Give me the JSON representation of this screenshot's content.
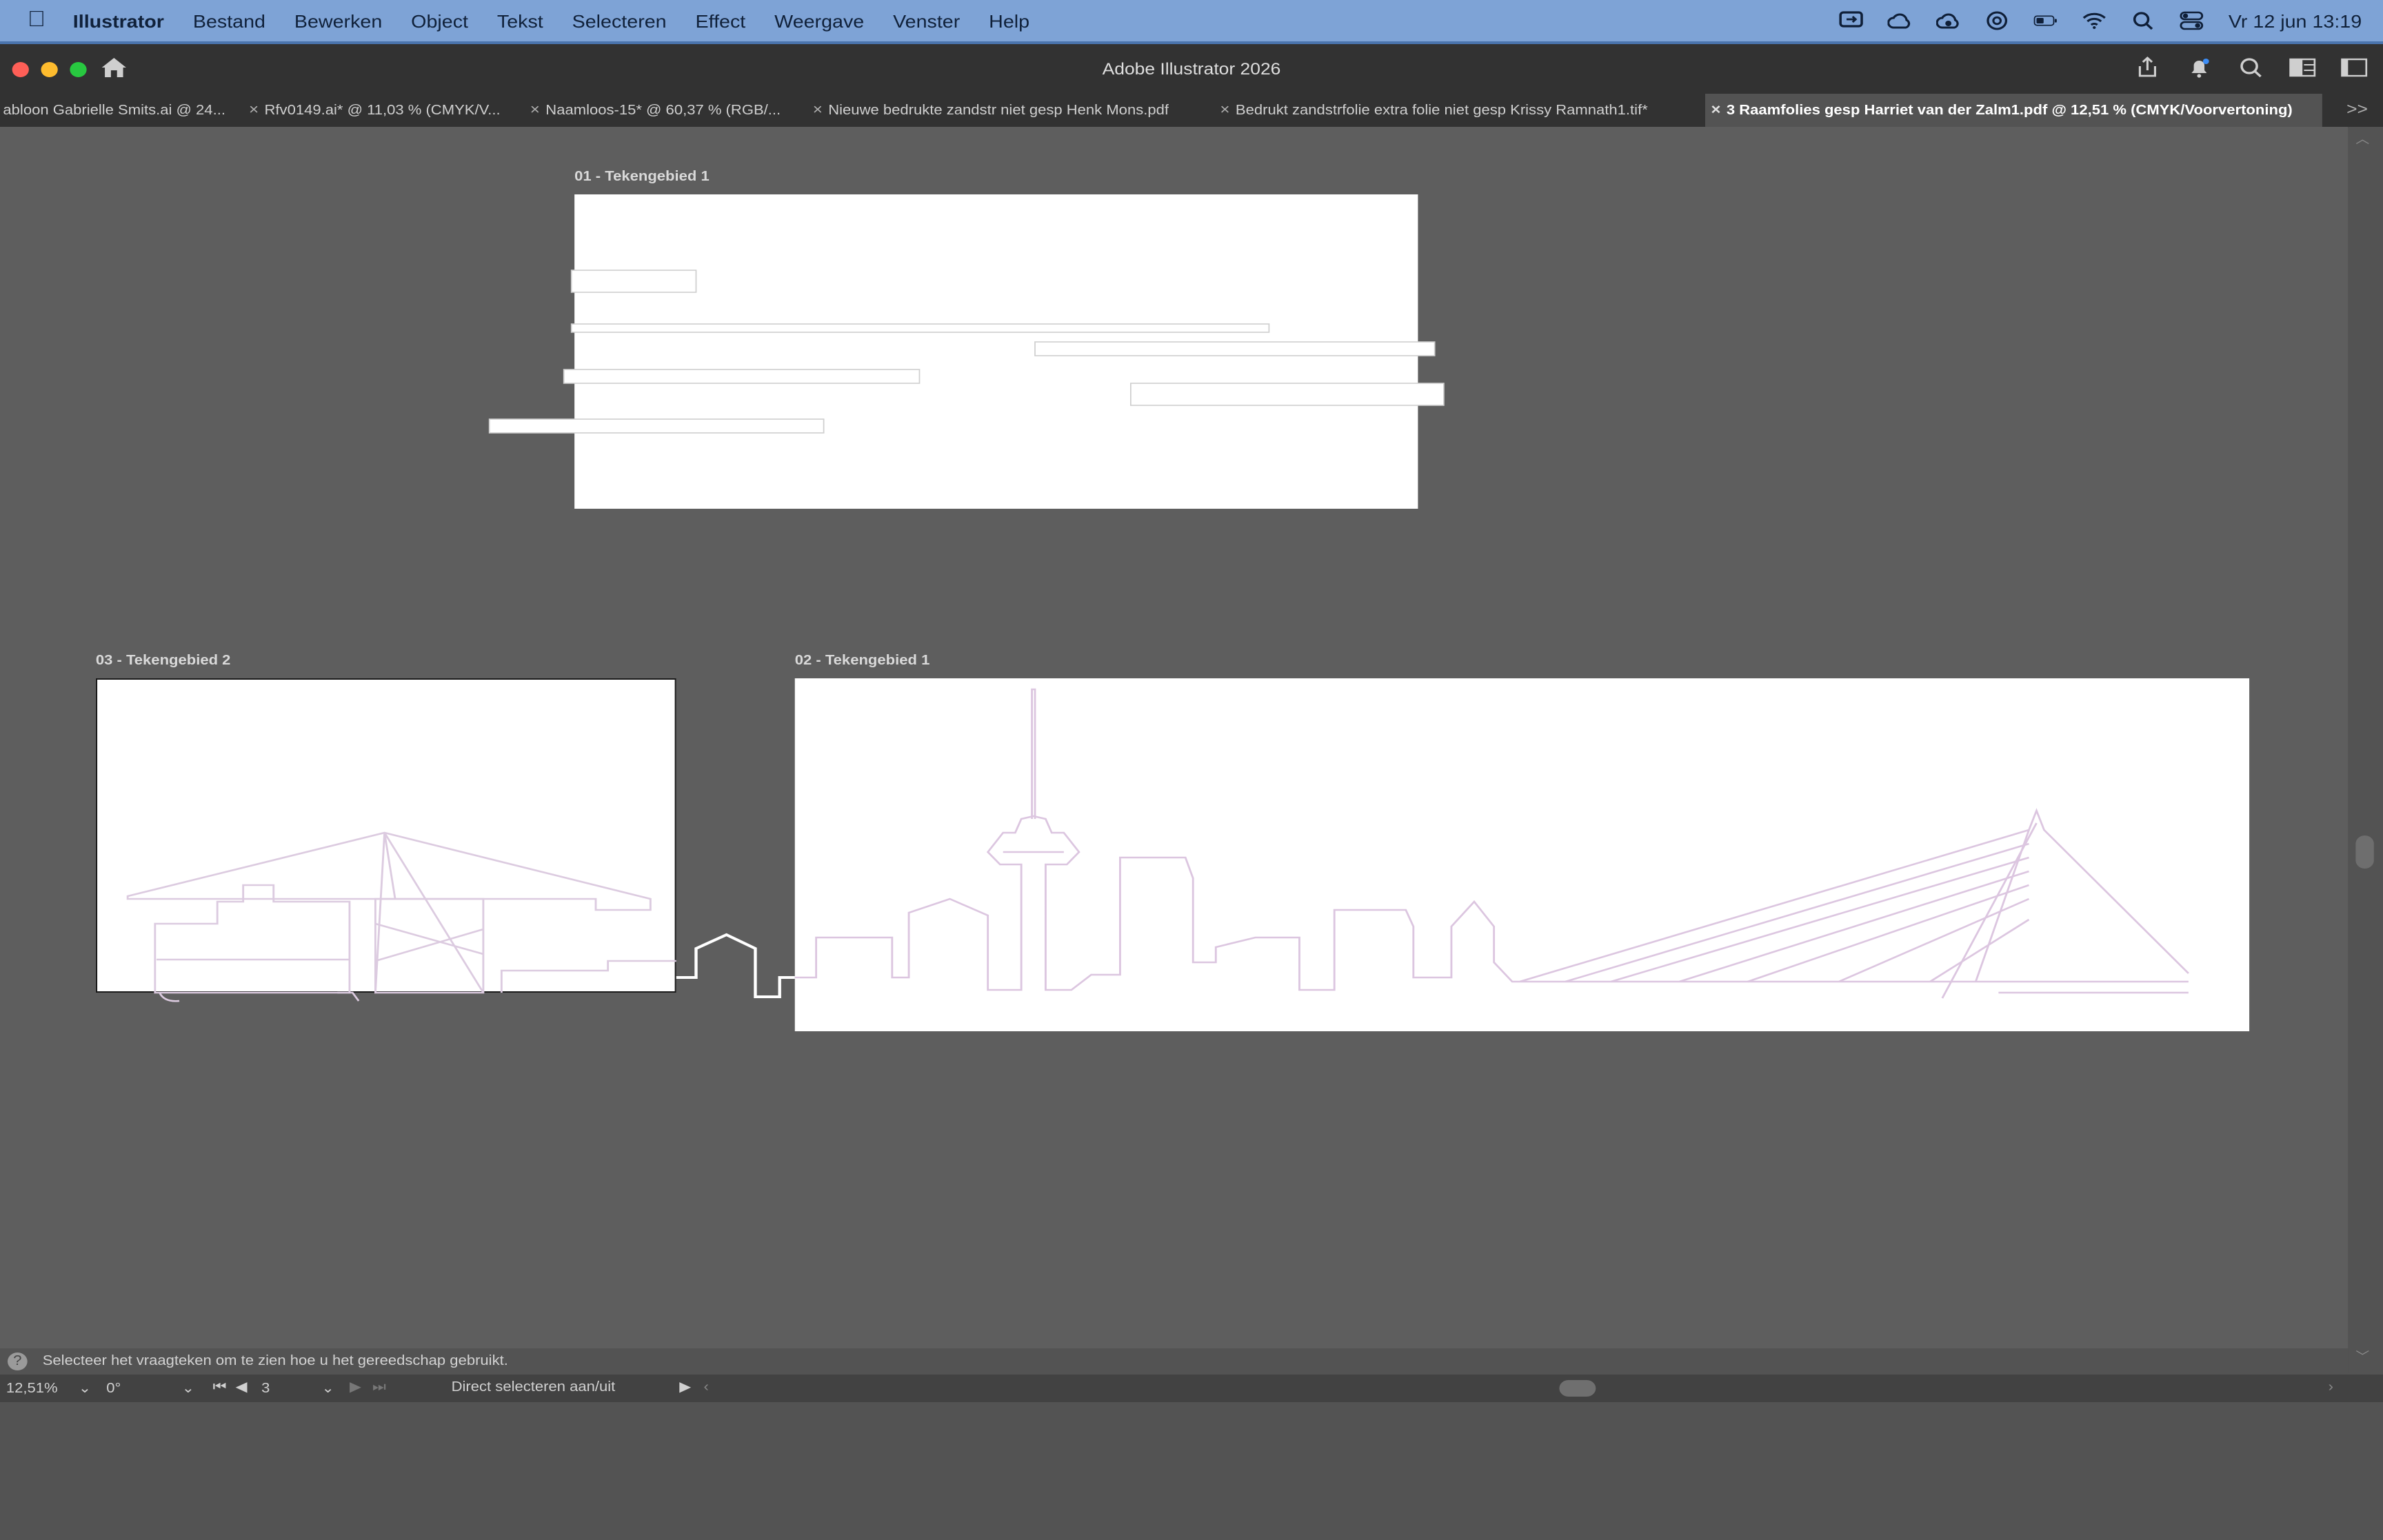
{
  "menubar": {
    "items": [
      "Illustrator",
      "Bestand",
      "Bewerken",
      "Object",
      "Tekst",
      "Selecteren",
      "Effect",
      "Weergave",
      "Venster",
      "Help"
    ],
    "clock": "Vr 12 jun  13:19"
  },
  "window": {
    "title": "Adobe Illustrator 2026"
  },
  "tabs": [
    {
      "label": "abloon Gabrielle Smits.ai @ 24..."
    },
    {
      "label": "Rfv0149.ai* @ 11,03 % (CMYK/V..."
    },
    {
      "label": "Naamloos-15* @ 60,37 % (RGB/..."
    },
    {
      "label": "Nieuwe bedrukte zandstr niet gesp Henk Mons.pdf"
    },
    {
      "label": "Bedrukt zandstrfolie extra folie niet gesp Krissy Ramnath1.tif*"
    },
    {
      "label": "3 Raamfolies gesp Harriet van der Zalm1.pdf @ 12,51 % (CMYK/Voorvertoning)"
    }
  ],
  "artboards": [
    {
      "label": "01 - Tekengebied 1"
    },
    {
      "label": "03 - Tekengebied 2"
    },
    {
      "label": "02 - Tekengebied 1"
    }
  ],
  "hint": {
    "text": "Selecteer het vraagteken om te zien hoe u het gereedschap gebruikt."
  },
  "statusbar": {
    "zoom": "12,51%",
    "rotation": "0°",
    "artboard_number": "3",
    "tool_status": "Direct selecteren aan/uit"
  },
  "colors": {
    "menubar": "#7ea3d6",
    "chrome": "#323232",
    "canvas": "#5e5e5e",
    "artboard": "#ffffff",
    "skyline_stroke": "#d9c6dc"
  }
}
